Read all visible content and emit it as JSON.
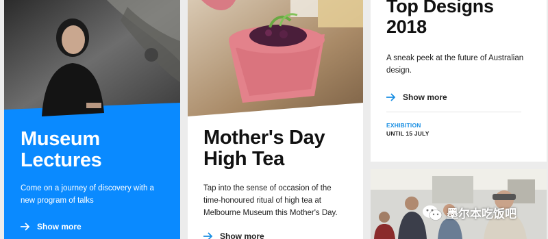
{
  "cards": [
    {
      "title_line1": "Museum",
      "title_line2": "Lectures",
      "description": "Come on a journey of discovery with a new program of talks",
      "link_label": "Show more"
    },
    {
      "title_line1": "Mother's Day",
      "title_line2": "High Tea",
      "description": "Tap into the sense of occasion of the time-honoured ritual of high tea at Melbourne Museum this Mother's Day.",
      "link_label": "Show more"
    },
    {
      "title_line1": "Top Designs",
      "title_line2": "2018",
      "description": "A sneak peek at the future of Australian design.",
      "link_label": "Show more",
      "category": "EXHIBITION",
      "date": "UNTIL 15 JULY"
    }
  ],
  "watermark": {
    "text": "墨尔本吃饭吧"
  },
  "colors": {
    "accent_blue": "#0a8aff",
    "link_blue": "#1a8fe3"
  }
}
